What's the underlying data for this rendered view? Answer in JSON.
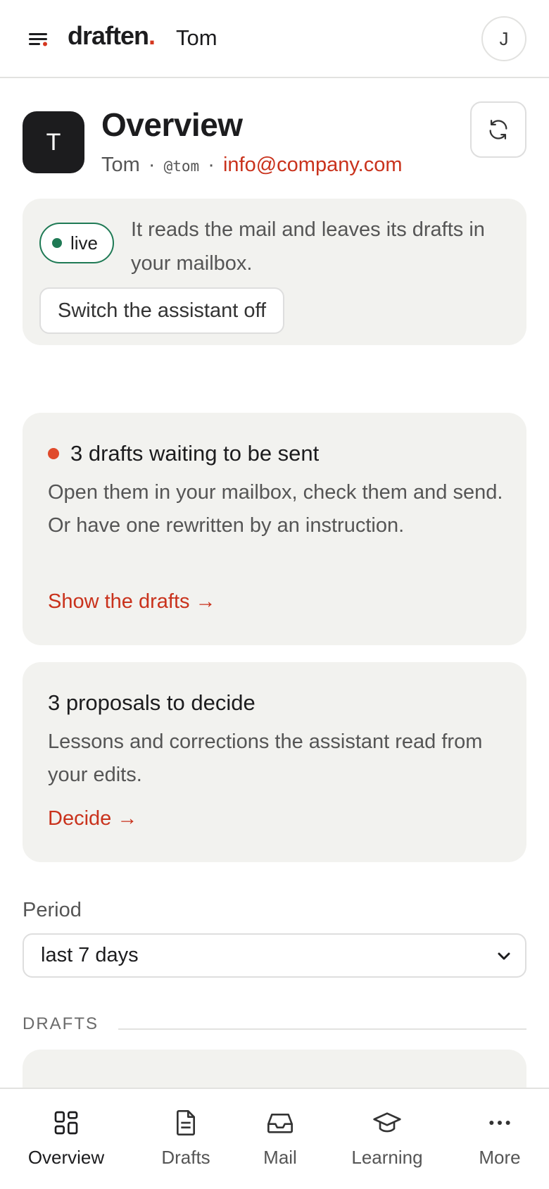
{
  "header": {
    "brand": "draften",
    "brand_dot": ".",
    "user_name": "Tom",
    "avatar_initial": "J"
  },
  "profile": {
    "avatar_initial": "T",
    "title": "Overview",
    "name": "Tom",
    "separator": "·",
    "handle": "@tom",
    "email": "info@company.com"
  },
  "assistant": {
    "status": "live",
    "description": "It reads the mail and leaves its drafts in your mailbox.",
    "switch_label": "Switch the assistant off"
  },
  "drafts_card": {
    "title": "3 drafts waiting to be sent",
    "body": "Open them in your mailbox, check them and send. Or have one rewritten by an instruction.",
    "link": "Show the drafts →"
  },
  "proposals_card": {
    "title": "3 proposals to decide",
    "body": "Lessons and corrections the assistant read from your edits.",
    "link": "Decide →"
  },
  "period": {
    "label": "Period",
    "selected": "last 7 days"
  },
  "section": {
    "drafts_label": "DRAFTS"
  },
  "nav": {
    "items": [
      {
        "label": "Overview",
        "icon": "grid-icon"
      },
      {
        "label": "Drafts",
        "icon": "document-icon"
      },
      {
        "label": "Mail",
        "icon": "inbox-icon"
      },
      {
        "label": "Learning",
        "icon": "graduation-cap-icon"
      },
      {
        "label": "More",
        "icon": "more-dots-icon"
      }
    ],
    "active": "Overview"
  },
  "colors": {
    "accent": "#c9321c",
    "live_green": "#1f7a55",
    "card_bg": "#f2f2ef"
  }
}
